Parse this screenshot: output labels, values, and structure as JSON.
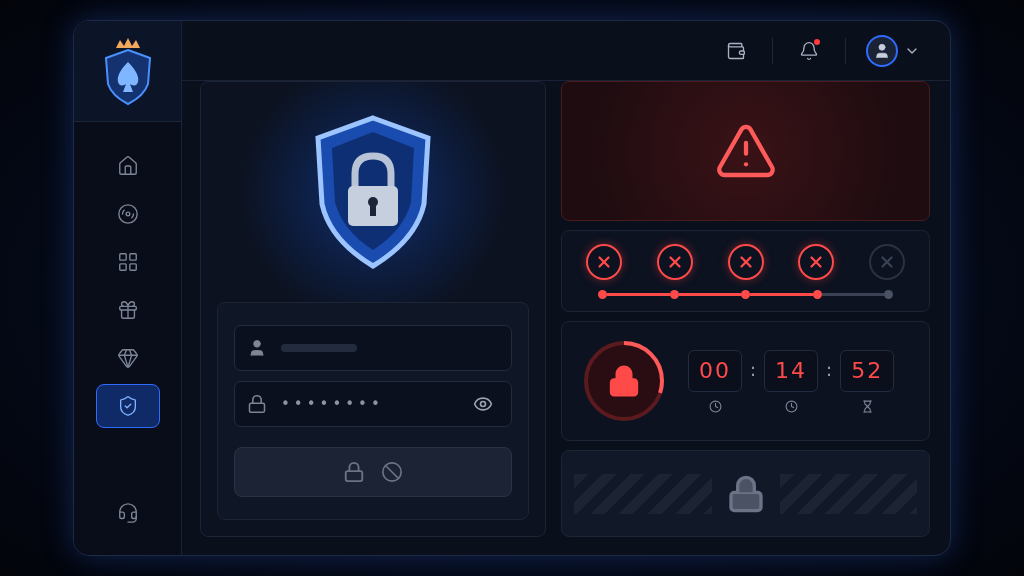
{
  "sidebar": {
    "items": [
      {
        "kind": "home",
        "selected": false
      },
      {
        "kind": "roulette",
        "selected": false
      },
      {
        "kind": "slots",
        "selected": false
      },
      {
        "kind": "gift",
        "selected": false
      },
      {
        "kind": "gem",
        "selected": false
      },
      {
        "kind": "security",
        "selected": true
      }
    ],
    "footer_item": {
      "kind": "support"
    }
  },
  "header": {
    "notifications": {
      "unread": true
    }
  },
  "login": {
    "password": {
      "value": "••••••••"
    },
    "submit": {
      "disabled": true
    }
  },
  "attempts": [
    {
      "failed": true
    },
    {
      "failed": true
    },
    {
      "failed": true
    },
    {
      "failed": true
    },
    {
      "failed": false
    }
  ],
  "lockout": {
    "level": 0.3
  },
  "timer": {
    "parts": [
      {
        "value": "00",
        "kind": "clock"
      },
      {
        "value": "14",
        "kind": "clock"
      },
      {
        "value": "52",
        "kind": "hourglass"
      }
    ],
    "separators": [
      ":",
      ":"
    ]
  }
}
